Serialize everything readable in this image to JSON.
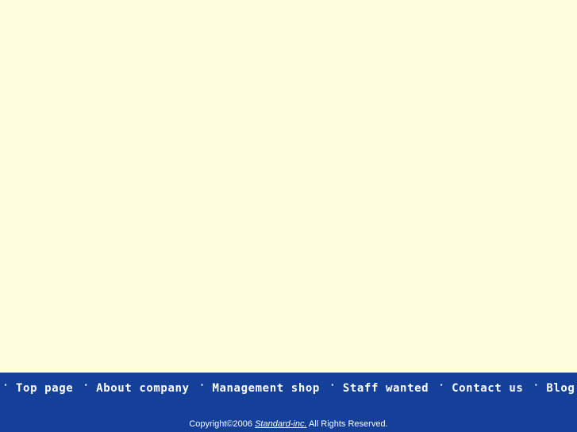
{
  "page": {
    "background_color": "#ffffe0",
    "content_area_label": "empty-content-area"
  },
  "footer": {
    "background_color": "#14409a",
    "text_color": "#ffffff",
    "bullet": "・",
    "nav_items": [
      {
        "label": "Top page"
      },
      {
        "label": "About company"
      },
      {
        "label": "Management shop"
      },
      {
        "label": "Staff wanted"
      },
      {
        "label": "Contact us"
      },
      {
        "label": "Blog"
      }
    ],
    "copyright": {
      "prefix": "Copyright©2006 ",
      "link_text": "Standard-inc.",
      "suffix": " All Rights Reserved."
    }
  }
}
